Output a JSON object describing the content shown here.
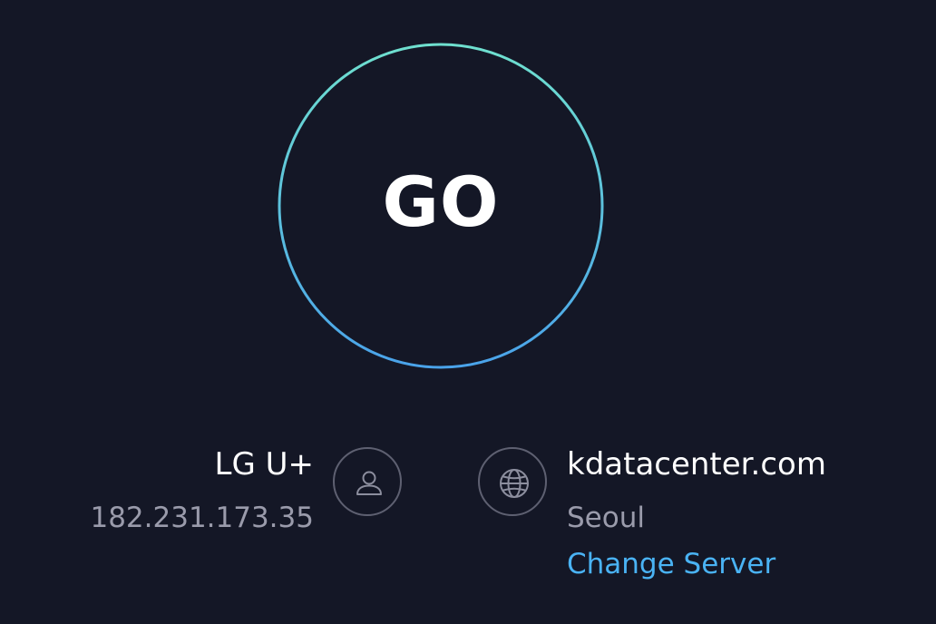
{
  "go_button": {
    "label": "GO"
  },
  "isp": {
    "name": "LG U+",
    "ip": "182.231.173.35",
    "icon": "user-icon"
  },
  "server": {
    "name": "kdatacenter.com",
    "city": "Seoul",
    "change_label": "Change Server",
    "icon": "globe-icon"
  },
  "colors": {
    "background": "#141726",
    "ring_top": "#6fe0cf",
    "ring_bottom": "#4aa3ea",
    "accent_link": "#4ab3f4",
    "muted_text": "#9a9bab"
  }
}
